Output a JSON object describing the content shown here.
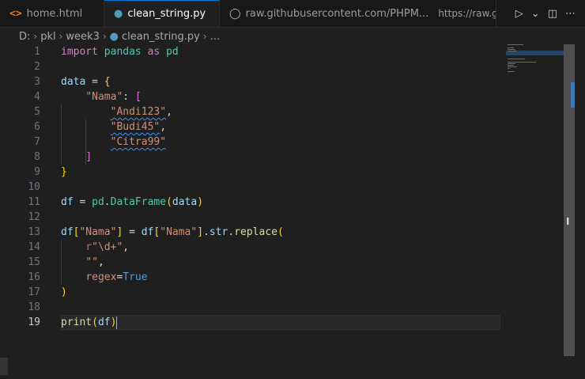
{
  "tabs": [
    {
      "label": "home.html",
      "icon": "html-file-icon"
    },
    {
      "label": "clean_string.py",
      "icon": "python-file-icon",
      "modified": true
    },
    {
      "label": "raw.githubusercontent.com/PHPM...",
      "icon": "globe-icon",
      "extra": "https://raw.githubus"
    }
  ],
  "breadcrumb": [
    "D:",
    "pkl",
    "week3",
    "clean_string.py",
    "..."
  ],
  "line_numbers": [
    "1",
    "2",
    "3",
    "4",
    "5",
    "6",
    "7",
    "8",
    "9",
    "10",
    "11",
    "12",
    "13",
    "14",
    "15",
    "16",
    "17",
    "18",
    "19"
  ],
  "code": {
    "import": "import",
    "pandas": "pandas",
    "as": "as",
    "pd": "pd",
    "data": "data",
    "eq": " = ",
    "lbrace": "{",
    "rbrace": "}",
    "nama_key": "\"Nama\"",
    "colon": ": ",
    "lbracket": "[",
    "rbracket": "]",
    "andi": "\"Andi123\"",
    "budi": "\"Budi45\"",
    "citra": "\"Citra99\"",
    "comma": ",",
    "df": "df",
    "dot": ".",
    "DataFrame": "DataFrame",
    "lparen": "(",
    "rparen": ")",
    "str": "str",
    "replace": "replace",
    "lsq": "[",
    "rsq": "]",
    "r": "r",
    "regex_pat": "\"\\d+\"",
    "empty": "\"\"",
    "regex_kw": "regex",
    "eq_nospace": "=",
    "True": "True",
    "print": "print"
  },
  "colors": {
    "accent": "#0078d4",
    "keyword": "#c586c0",
    "string": "#ce9178",
    "variable": "#9cdcfe"
  }
}
